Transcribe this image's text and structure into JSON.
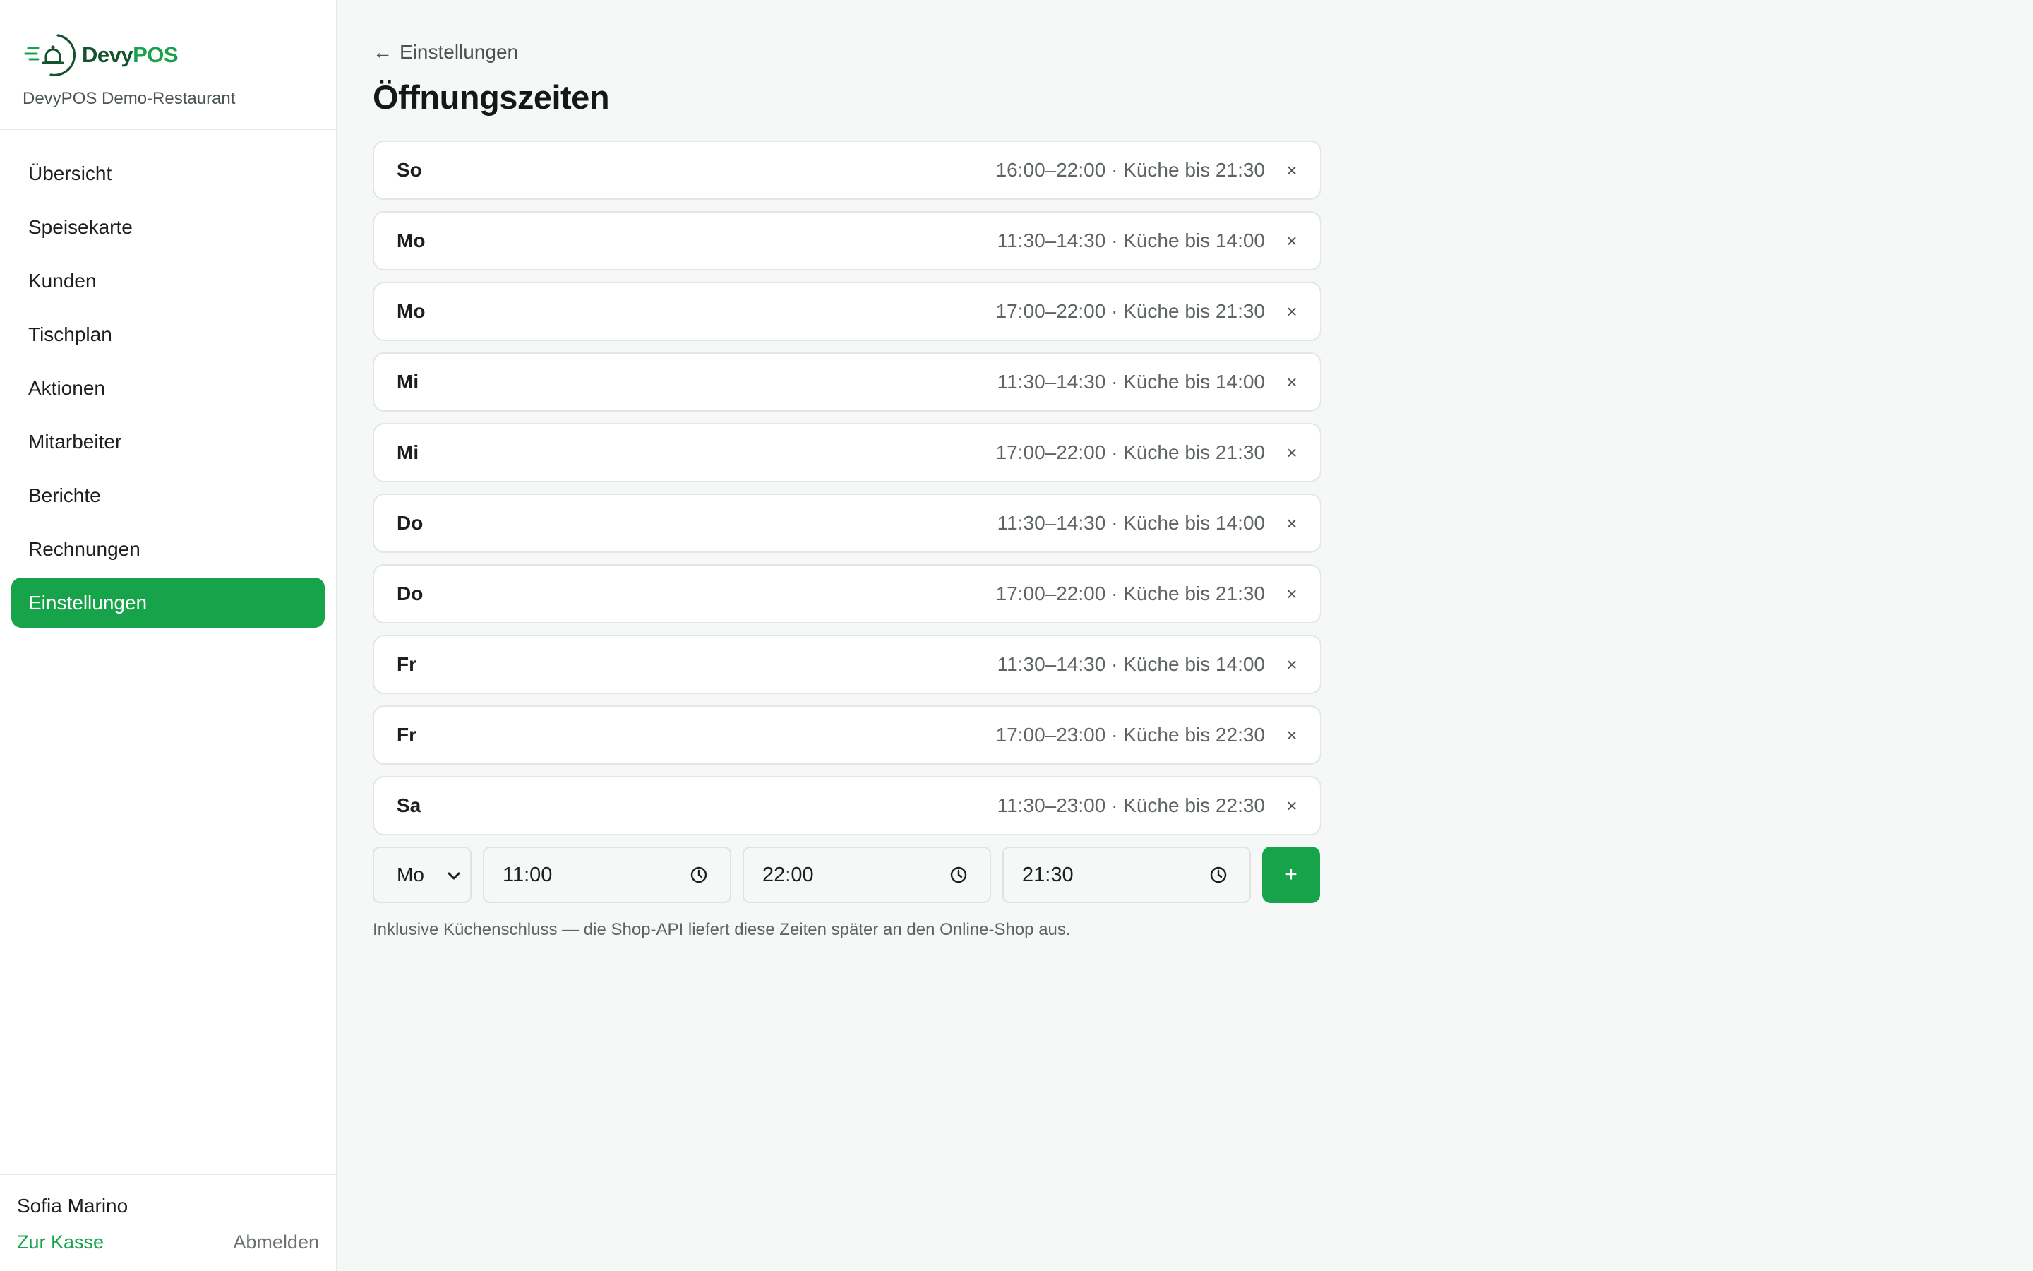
{
  "brand": {
    "logo_part1": "Devy",
    "logo_part2": "POS",
    "restaurant": "DevyPOS Demo-Restaurant",
    "accent_color": "#16a34a",
    "dark_color": "#14532d",
    "logo_icon": "bell-icon"
  },
  "nav": {
    "items": [
      {
        "label": "Übersicht"
      },
      {
        "label": "Speisekarte"
      },
      {
        "label": "Kunden"
      },
      {
        "label": "Tischplan"
      },
      {
        "label": "Aktionen"
      },
      {
        "label": "Mitarbeiter"
      },
      {
        "label": "Berichte"
      },
      {
        "label": "Rechnungen"
      },
      {
        "label": "Einstellungen",
        "active": true
      }
    ]
  },
  "user": {
    "name": "Sofia Marino",
    "to_kasse": "Zur Kasse",
    "logout": "Abmelden"
  },
  "page": {
    "back_label": "Einstellungen",
    "title": "Öffnungszeiten"
  },
  "hours": [
    {
      "day": "So",
      "times": "16:00–22:00 · Küche bis 21:30"
    },
    {
      "day": "Mo",
      "times": "11:30–14:30 · Küche bis 14:00"
    },
    {
      "day": "Mo",
      "times": "17:00–22:00 · Küche bis 21:30"
    },
    {
      "day": "Mi",
      "times": "11:30–14:30 · Küche bis 14:00"
    },
    {
      "day": "Mi",
      "times": "17:00–22:00 · Küche bis 21:30"
    },
    {
      "day": "Do",
      "times": "11:30–14:30 · Küche bis 14:00"
    },
    {
      "day": "Do",
      "times": "17:00–22:00 · Küche bis 21:30"
    },
    {
      "day": "Fr",
      "times": "11:30–14:30 · Küche bis 14:00"
    },
    {
      "day": "Fr",
      "times": "17:00–23:00 · Küche bis 22:30"
    },
    {
      "day": "Sa",
      "times": "11:30–23:00 · Küche bis 22:30"
    }
  ],
  "remove_symbol": "×",
  "add_form": {
    "day_value": "Mo",
    "open_time": "11:00",
    "close_time": "22:00",
    "kitchen_close": "21:30",
    "add_label": "+"
  },
  "hint": "Inklusive Küchenschluss — die Shop-API liefert diese Zeiten später an den Online-Shop aus."
}
